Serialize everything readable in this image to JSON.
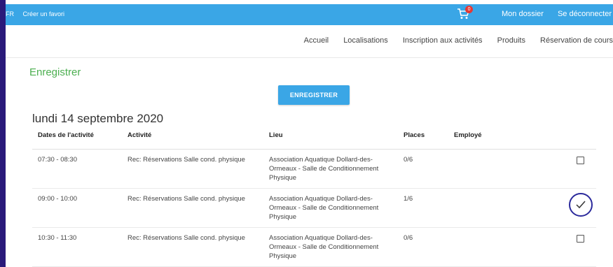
{
  "topbar": {
    "lang": "FR",
    "favorite": "Créer un favori",
    "cart_count": "0",
    "my_account": "Mon dossier",
    "logout": "Se déconnecter"
  },
  "nav": {
    "items": [
      "Accueil",
      "Localisations",
      "Inscription aux activités",
      "Produits",
      "Réservation de cours"
    ]
  },
  "page": {
    "title": "Enregistrer",
    "register_button": "ENREGISTRER",
    "day": "lundi 14 septembre 2020"
  },
  "table": {
    "headers": [
      "Dates de l'activité",
      "Activité",
      "Lieu",
      "Places",
      "Employé"
    ],
    "rows": [
      {
        "time": "07:30 - 08:30",
        "activity": "Rec: Réservations Salle cond. physique",
        "place": "Association Aquatique Dollard-des-Ormeaux - Salle de Conditionnement Physique",
        "slots": "0/6",
        "employee": "",
        "checked": false
      },
      {
        "time": "09:00 - 10:00",
        "activity": "Rec: Réservations Salle cond. physique",
        "place": "Association Aquatique Dollard-des-Ormeaux - Salle de Conditionnement Physique",
        "slots": "1/6",
        "employee": "",
        "checked": true
      },
      {
        "time": "10:30 - 11:30",
        "activity": "Rec: Réservations Salle cond. physique",
        "place": "Association Aquatique Dollard-des-Ormeaux - Salle de Conditionnement Physique",
        "slots": "0/6",
        "employee": "",
        "checked": false
      }
    ]
  },
  "colors": {
    "topbar": "#3aa6e6",
    "title_green": "#4caf50",
    "highlight_circle": "#2b2a9c",
    "badge": "#e53935"
  }
}
